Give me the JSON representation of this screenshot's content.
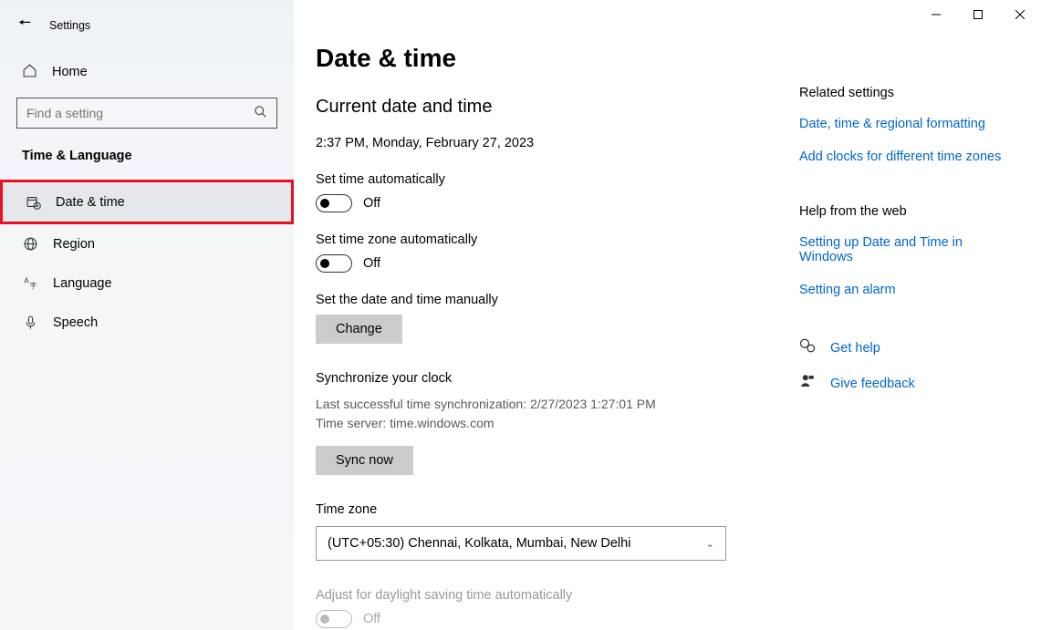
{
  "appTitle": "Settings",
  "sidebar": {
    "home": "Home",
    "searchPlaceholder": "Find a setting",
    "category": "Time & Language",
    "items": [
      {
        "label": "Date & time"
      },
      {
        "label": "Region"
      },
      {
        "label": "Language"
      },
      {
        "label": "Speech"
      }
    ]
  },
  "main": {
    "title": "Date & time",
    "currentHead": "Current date and time",
    "currentValue": "2:37 PM, Monday, February 27, 2023",
    "setTimeAuto": {
      "label": "Set time automatically",
      "state": "Off"
    },
    "setTzAuto": {
      "label": "Set time zone automatically",
      "state": "Off"
    },
    "manual": {
      "label": "Set the date and time manually",
      "button": "Change"
    },
    "sync": {
      "head": "Synchronize your clock",
      "lastSync": "Last successful time synchronization: 2/27/2023 1:27:01 PM",
      "server": "Time server: time.windows.com",
      "button": "Sync now"
    },
    "timezone": {
      "label": "Time zone",
      "value": "(UTC+05:30) Chennai, Kolkata, Mumbai, New Delhi"
    },
    "dst": {
      "label": "Adjust for daylight saving time automatically",
      "state": "Off"
    }
  },
  "rightCol": {
    "relatedHead": "Related settings",
    "relatedLinks": [
      "Date, time & regional formatting",
      "Add clocks for different time zones"
    ],
    "helpHead": "Help from the web",
    "helpLinks": [
      "Setting up Date and Time in Windows",
      "Setting an alarm"
    ],
    "getHelp": "Get help",
    "feedback": "Give feedback"
  }
}
